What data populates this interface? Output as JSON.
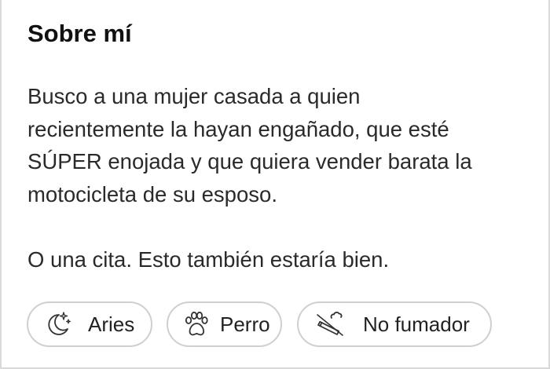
{
  "about": {
    "title": "Sobre mí",
    "bio_lines": [
      "Busco a una mujer casada a quien",
      "recientemente la hayan engañado, que esté",
      "SÚPER enojada y que quiera vender barata la",
      "motocicleta de su esposo."
    ],
    "bio_second": "O una cita. Esto también estaría bien."
  },
  "chips": [
    {
      "label": "Aries",
      "icon": "moon-stars-icon"
    },
    {
      "label": "Perro",
      "icon": "paw-icon"
    },
    {
      "label": "No fumador",
      "icon": "no-smoking-icon"
    }
  ]
}
